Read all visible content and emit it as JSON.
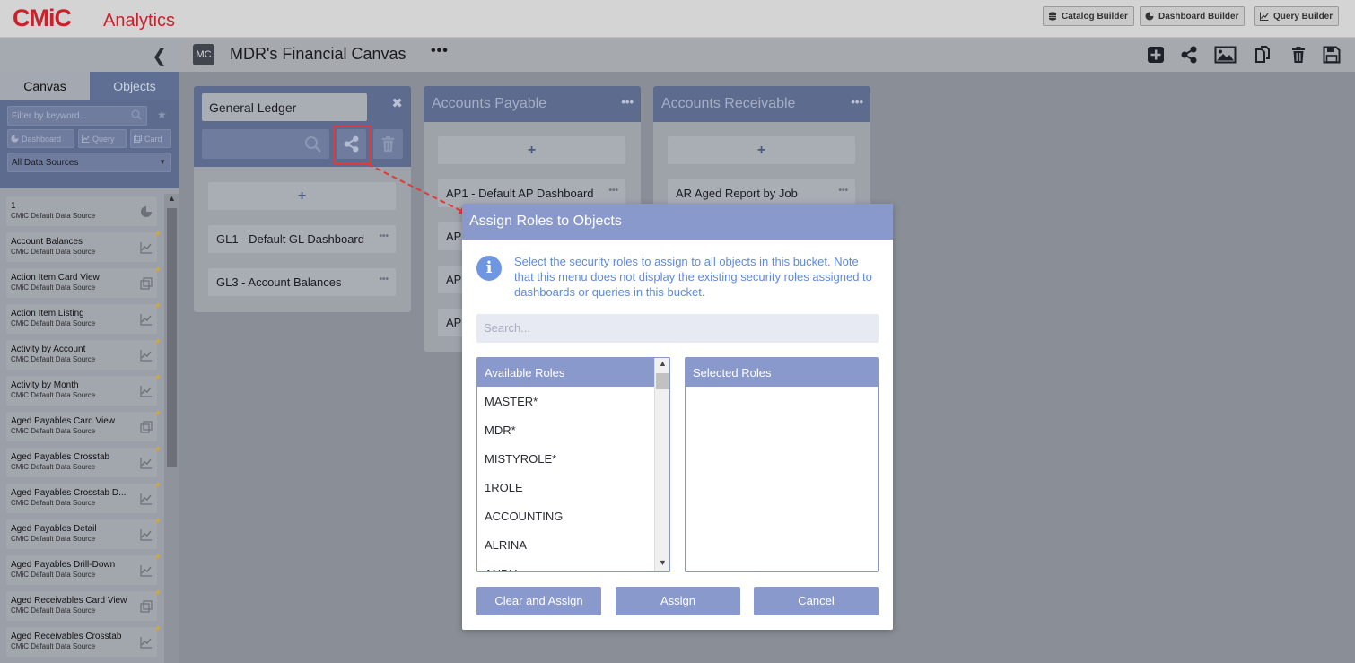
{
  "header": {
    "logo_text": "CMiC",
    "app_name": "Analytics",
    "builders": [
      {
        "label": "Catalog Builder",
        "icon": "database-icon"
      },
      {
        "label": "Dashboard Builder",
        "icon": "dashboard-icon"
      },
      {
        "label": "Query Builder",
        "icon": "line-chart-icon"
      }
    ]
  },
  "sidebar": {
    "tabs": [
      {
        "label": "Canvas",
        "active": true
      },
      {
        "label": "Objects",
        "active": false
      }
    ],
    "filter_placeholder": "Filter by keyword...",
    "type_buttons": [
      "Dashboard",
      "Query",
      "Card"
    ],
    "data_source": "All Data Sources",
    "items": [
      {
        "title": "1",
        "source": "CMiC Default Data Source",
        "icon": "pie-chart-icon",
        "fav": false
      },
      {
        "title": "Account Balances",
        "source": "CMiC Default Data Source",
        "icon": "line-chart-icon",
        "fav": true
      },
      {
        "title": "Action Item Card View",
        "source": "CMiC Default Data Source",
        "icon": "card-icon",
        "fav": true
      },
      {
        "title": "Action Item Listing",
        "source": "CMiC Default Data Source",
        "icon": "line-chart-icon",
        "fav": true
      },
      {
        "title": "Activity by Account",
        "source": "CMiC Default Data Source",
        "icon": "line-chart-icon",
        "fav": true
      },
      {
        "title": "Activity by Month",
        "source": "CMiC Default Data Source",
        "icon": "line-chart-icon",
        "fav": true
      },
      {
        "title": "Aged Payables Card View",
        "source": "CMiC Default Data Source",
        "icon": "card-icon",
        "fav": true
      },
      {
        "title": "Aged Payables Crosstab",
        "source": "CMiC Default Data Source",
        "icon": "line-chart-icon",
        "fav": true
      },
      {
        "title": "Aged Payables Crosstab D...",
        "source": "CMiC Default Data Source",
        "icon": "line-chart-icon",
        "fav": true
      },
      {
        "title": "Aged Payables Detail",
        "source": "CMiC Default Data Source",
        "icon": "line-chart-icon",
        "fav": true
      },
      {
        "title": "Aged Payables Drill-Down",
        "source": "CMiC Default Data Source",
        "icon": "line-chart-icon",
        "fav": true
      },
      {
        "title": "Aged Receivables Card View",
        "source": "CMiC Default Data Source",
        "icon": "card-icon",
        "fav": true
      },
      {
        "title": "Aged Receivables Crosstab",
        "source": "CMiC Default Data Source",
        "icon": "line-chart-icon",
        "fav": true
      }
    ]
  },
  "canvas": {
    "badge": "MC",
    "title": "MDR's Financial Canvas",
    "menu": "•••"
  },
  "buckets": {
    "gl": {
      "name_value": "General Ledger",
      "cards": [
        "GL1 - Default GL Dashboard",
        "GL3 - Account Balances"
      ]
    },
    "ap": {
      "title": "Accounts Payable",
      "cards": [
        "AP1 - Default AP Dashboard",
        "AP",
        "AP",
        "AP"
      ]
    },
    "ar": {
      "title": "Accounts Receivable",
      "cards": [
        "AR Aged Report by Job"
      ]
    },
    "add_symbol": "+",
    "dots": "•••"
  },
  "modal": {
    "title": "Assign Roles to Objects",
    "info_text": "Select the security roles to assign to all objects in this bucket. Note that this menu does not display the existing security roles assigned to dashboards or queries in this bucket.",
    "search_placeholder": "Search...",
    "available_header": "Available Roles",
    "selected_header": "Selected Roles",
    "available_roles": [
      "MASTER*",
      "MDR*",
      "MISTYROLE*",
      "1ROLE",
      "ACCOUNTING",
      "ALRINA",
      "ANDY"
    ],
    "buttons": {
      "clear_assign": "Clear and Assign",
      "assign": "Assign",
      "cancel": "Cancel"
    }
  },
  "colors": {
    "brand_red": "#c8232c",
    "modal_accent": "#8a99cc",
    "info_blue": "#5d8ae0",
    "highlight_red": "#e03a3a"
  }
}
